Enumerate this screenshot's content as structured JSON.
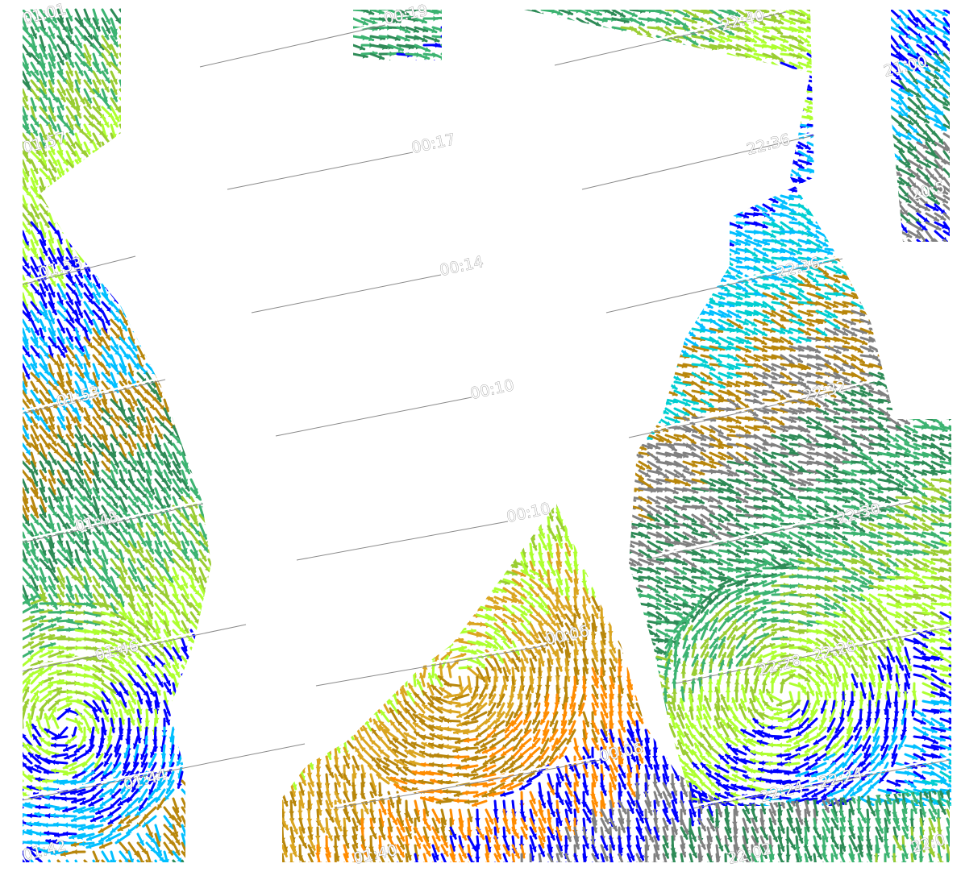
{
  "colors": {
    "background": "#ffffff",
    "wind_dark_green": "#2e8b57",
    "wind_green": "#3cb371",
    "wind_light_green": "#9acd32",
    "wind_lime": "#adff2f",
    "wind_blue": "#0000ff",
    "wind_sky": "#00bfff",
    "wind_cyan": "#00ced1",
    "wind_gold": "#daa520",
    "wind_brown": "#b8860b",
    "wind_orange": "#ff8c00",
    "wind_gray": "#808080",
    "track": "#808080"
  },
  "timestamps_center": [
    "00:19",
    "00:17",
    "00:14",
    "00:10",
    "00:10",
    "00:06",
    "00:06",
    "01:40"
  ],
  "timestamps_right": [
    "22:40",
    "22:36",
    "22:36",
    "22:32",
    "22:30",
    "22:28",
    "22:28",
    "22:24",
    "22:24",
    "22:02"
  ],
  "timestamps_left": [
    "01:01",
    "01:57",
    "01:53",
    "01:53",
    "01:48",
    "01:46",
    "01:44",
    "01:42"
  ],
  "timestamps_far_right": [
    "21:00",
    "20:5",
    "22:0"
  ]
}
